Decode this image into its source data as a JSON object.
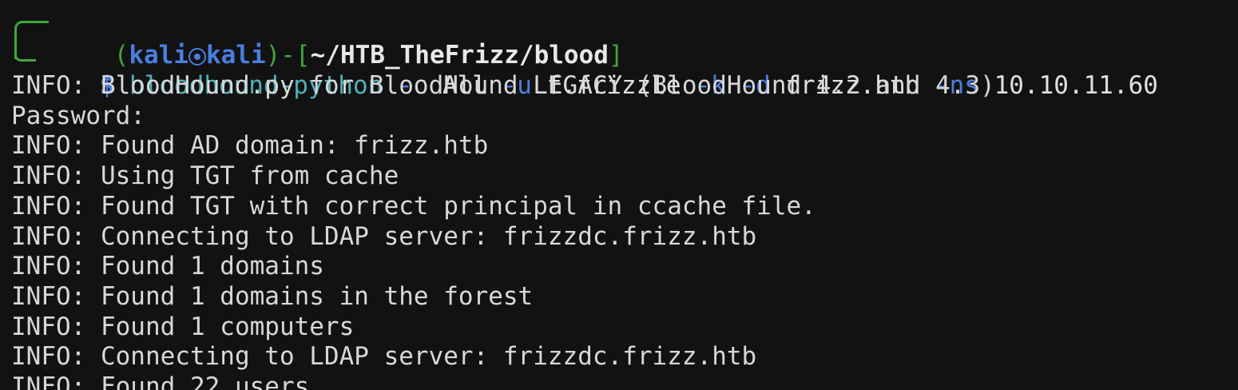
{
  "prompt": {
    "open_paren": "(",
    "user": "kali",
    "host": "kali",
    "close_bracket_dash": ")-[",
    "path": "~/HTB_TheFrizz/blood",
    "close_bracket": "]",
    "dollar": "$"
  },
  "command": {
    "program": "bloodhound-python",
    "tokens": [
      {
        "text": "-c",
        "kind": "flag"
      },
      {
        "text": "All",
        "kind": "arg"
      },
      {
        "text": "-u",
        "kind": "flag"
      },
      {
        "text": "f.frizzle",
        "kind": "arg"
      },
      {
        "text": "-k",
        "kind": "flag"
      },
      {
        "text": "-d",
        "kind": "flag"
      },
      {
        "text": "frizz.htb",
        "kind": "arg"
      },
      {
        "text": "-ns",
        "kind": "flag"
      },
      {
        "text": "10.10.11.60",
        "kind": "arg"
      }
    ]
  },
  "output": [
    "INFO: BloodHound.py for BloodHound LEGACY (BloodHound 4.2 and 4.3)",
    "Password:",
    "INFO: Found AD domain: frizz.htb",
    "INFO: Using TGT from cache",
    "INFO: Found TGT with correct principal in ccache file.",
    "INFO: Connecting to LDAP server: frizzdc.frizz.htb",
    "INFO: Found 1 domains",
    "INFO: Found 1 domains in the forest",
    "INFO: Found 1 computers",
    "INFO: Connecting to LDAP server: frizzdc.frizz.htb",
    "INFO: Found 22 users"
  ],
  "colors": {
    "background": "#121212",
    "prompt_green": "#3fa63f",
    "prompt_blue": "#4a7ee0",
    "command_cyan": "#4fb1b8",
    "text": "#d8d8d8"
  }
}
